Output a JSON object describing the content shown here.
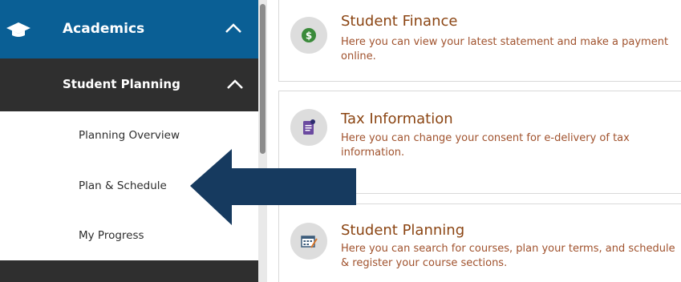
{
  "sidebar": {
    "academics_label": "Academics",
    "student_planning_label": "Student Planning",
    "items": [
      {
        "label": "Planning Overview"
      },
      {
        "label": "Plan & Schedule"
      },
      {
        "label": "My Progress"
      }
    ],
    "icons": {
      "academics": "graduation-cap-icon",
      "academics_toggle": "chevron-up-icon",
      "student_planning_toggle": "chevron-up-icon"
    }
  },
  "cards": [
    {
      "title": "Student Finance",
      "description": "Here you can view your latest statement and make a payment online.",
      "icon": "dollar-icon"
    },
    {
      "title": "Tax Information",
      "description": "Here you can change your consent for e-delivery of tax information.",
      "icon": "tax-document-icon"
    },
    {
      "title": "Student Planning",
      "description": "Here you can search for courses, plan your terms, and schedule & register your course sections.",
      "icon": "calendar-icon"
    }
  ],
  "annotation": {
    "icon": "pointer-arrow-icon",
    "color": "#163a5f"
  },
  "colors": {
    "primary": "#0a5f95",
    "dark": "#2f2f2f",
    "title_text": "#8b4513"
  }
}
